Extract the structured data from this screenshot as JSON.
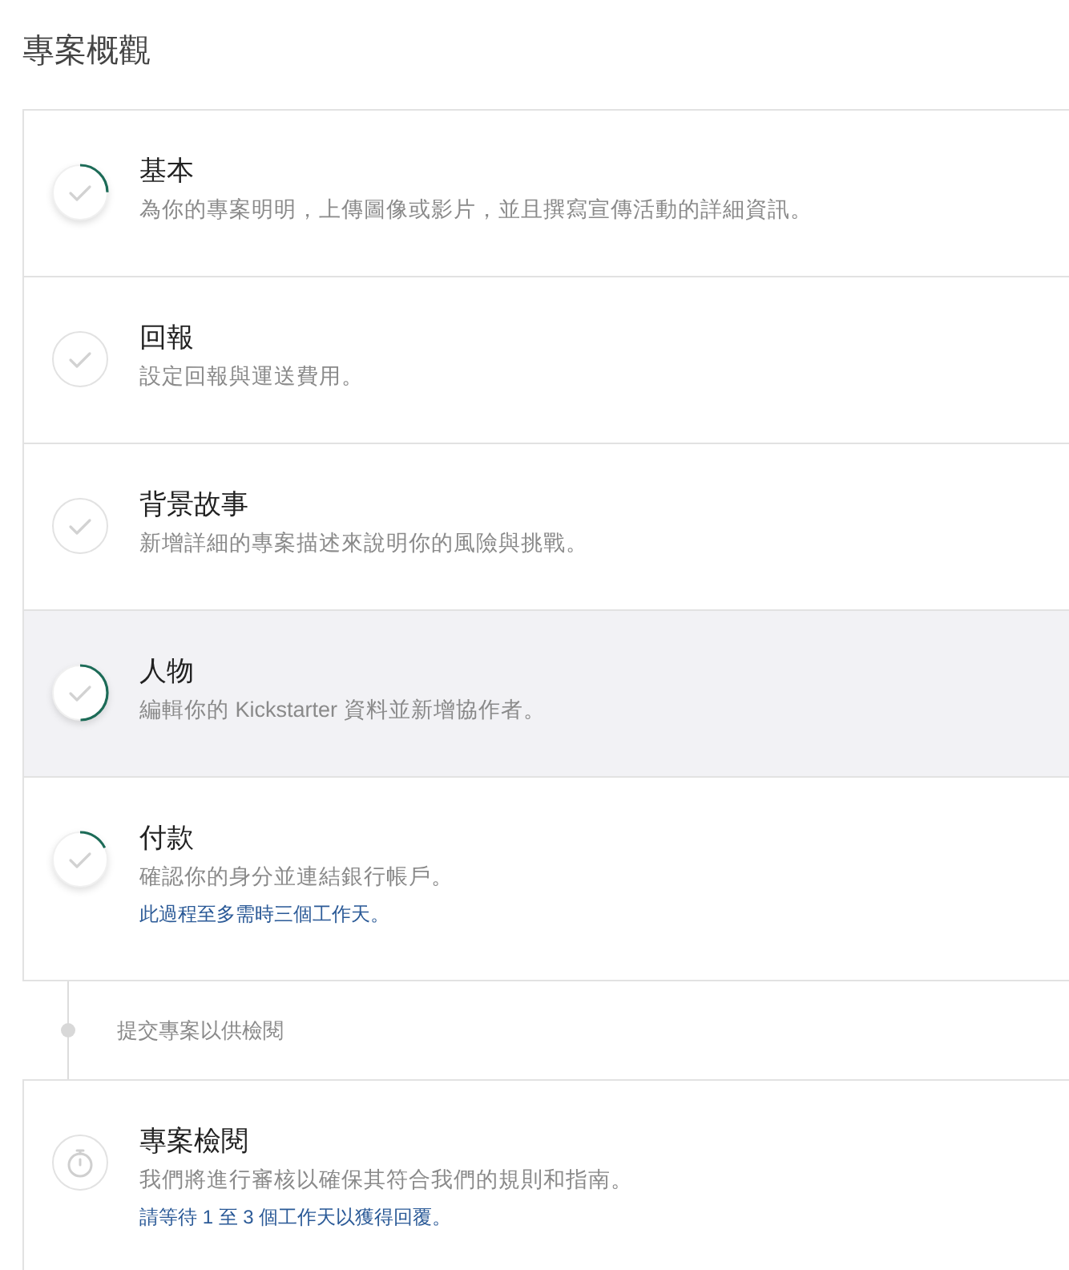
{
  "page": {
    "title": "專案概觀"
  },
  "steps": [
    {
      "title": "基本",
      "description": "為你的專案明明，上傳圖像或影片，並且撰寫宣傳活動的詳細資訊。",
      "level": 0.25,
      "selected": false
    },
    {
      "title": "回報",
      "description": "設定回報與運送費用。",
      "level": 0,
      "selected": false
    },
    {
      "title": "背景故事",
      "description": "新增詳細的專案描述來說明你的風險與挑戰。",
      "level": 0,
      "selected": false
    },
    {
      "title": "人物",
      "description": "編輯你的 Kickstarter 資料並新增協作者。",
      "level": 0.5,
      "selected": true
    },
    {
      "title": "付款",
      "description": "確認你的身分並連結銀行帳戶。",
      "note": "此過程至多需時三個工作天。",
      "level": 0.18,
      "selected": false
    }
  ],
  "submit": {
    "label": "提交專案以供檢閱"
  },
  "review": {
    "title": "專案檢閱",
    "description": "我們將進行審核以確保其符合我們的規則和指南。",
    "note": "請等待 1 至 3 個工作天以獲得回覆。"
  }
}
